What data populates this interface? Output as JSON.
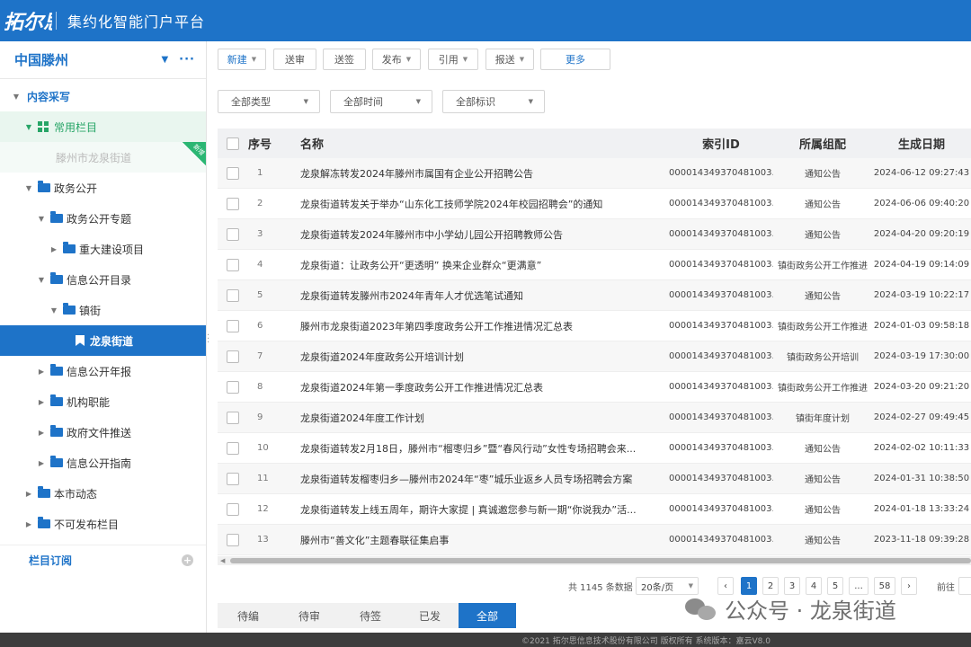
{
  "header": {
    "logo_text": "拓尔思",
    "app_title": "集约化智能门户平台"
  },
  "site": {
    "name": "中国滕州",
    "dropdown_glyph": "▼",
    "more_glyph": "···"
  },
  "sidebar": {
    "content_section": "内容采写",
    "common_columns": "常用栏目",
    "faded_item": "滕州市龙泉街道",
    "new_badge": "新增",
    "gov_public": "政务公开",
    "gov_special": "政务公开专题",
    "major_projects": "重大建设项目",
    "info_catalog": "信息公开目录",
    "towns": "镇街",
    "active_item": "龙泉街道",
    "annual_report": "信息公开年报",
    "org_functions": "机构职能",
    "gov_docs": "政府文件推送",
    "info_guide": "信息公开指南",
    "city_news": "本市动态",
    "unpublishable": "不可发布栏目",
    "column_subscribe": "栏目订阅"
  },
  "toolbar": {
    "new": "新建",
    "review": "送审",
    "sign": "送签",
    "publish": "发布",
    "cite": "引用",
    "submit": "报送",
    "more": "更多"
  },
  "filters": {
    "type": "全部类型",
    "time": "全部时间",
    "tag": "全部标识"
  },
  "table": {
    "headers": {
      "no": "序号",
      "name": "名称",
      "index_id": "索引ID",
      "group": "所属组配",
      "date": "生成日期"
    },
    "rows": [
      {
        "no": "1",
        "name": "龙泉解冻转发2024年滕州市属国有企业公开招聘公告",
        "index_id": "000014349370481003...",
        "group": "通知公告",
        "date": "2024-06-12 09:27:43"
      },
      {
        "no": "2",
        "name": "龙泉街道转发关于举办“山东化工技师学院2024年校园招聘会”的通知",
        "index_id": "000014349370481003...",
        "group": "通知公告",
        "date": "2024-06-06 09:40:20"
      },
      {
        "no": "3",
        "name": "龙泉街道转发2024年滕州市中小学幼儿园公开招聘教师公告",
        "index_id": "000014349370481003...",
        "group": "通知公告",
        "date": "2024-04-20 09:20:19"
      },
      {
        "no": "4",
        "name": "龙泉街道：让政务公开“更透明” 换来企业群众“更满意”",
        "index_id": "000014349370481003...",
        "group": "镇街政务公开工作推进",
        "date": "2024-04-19 09:14:09"
      },
      {
        "no": "5",
        "name": "龙泉街道转发滕州市2024年青年人才优选笔试通知",
        "index_id": "000014349370481003...",
        "group": "通知公告",
        "date": "2024-03-19 10:22:17"
      },
      {
        "no": "6",
        "name": "滕州市龙泉街道2023年第四季度政务公开工作推进情况汇总表",
        "index_id": "000014349370481003...",
        "group": "镇街政务公开工作推进",
        "date": "2024-01-03 09:58:18"
      },
      {
        "no": "7",
        "name": "龙泉街道2024年度政务公开培训计划",
        "index_id": "000014349370481003...",
        "group": "镇街政务公开培训",
        "date": "2024-03-19 17:30:00"
      },
      {
        "no": "8",
        "name": "龙泉街道2024年第一季度政务公开工作推进情况汇总表",
        "index_id": "000014349370481003...",
        "group": "镇街政务公开工作推进",
        "date": "2024-03-20 09:21:20"
      },
      {
        "no": "9",
        "name": "龙泉街道2024年度工作计划",
        "index_id": "000014349370481003...",
        "group": "镇街年度计划",
        "date": "2024-02-27 09:49:45"
      },
      {
        "no": "10",
        "name": "龙泉街道转发2月18日，滕州市“榴枣归乡”暨“春风行动”女性专场招聘会来...",
        "index_id": "000014349370481003...",
        "group": "通知公告",
        "date": "2024-02-02 10:11:33"
      },
      {
        "no": "11",
        "name": "龙泉街道转发榴枣归乡—滕州市2024年“枣”城乐业返乡人员专场招聘会方案",
        "index_id": "000014349370481003...",
        "group": "通知公告",
        "date": "2024-01-31 10:38:50"
      },
      {
        "no": "12",
        "name": "龙泉街道转发上线五周年，期许大家提 | 真诚邀您参与新一期“你说我办”活...",
        "index_id": "000014349370481003...",
        "group": "通知公告",
        "date": "2024-01-18 13:33:24"
      },
      {
        "no": "13",
        "name": "滕州市“善文化”主题春联征集启事",
        "index_id": "000014349370481003...",
        "group": "通知公告",
        "date": "2023-11-18 09:39:28"
      }
    ]
  },
  "pagination": {
    "total": "共 1145 条数据",
    "page_size": "20条/页",
    "prev": "‹",
    "next": "›",
    "pages": [
      "1",
      "2",
      "3",
      "4",
      "5",
      "...",
      "58"
    ],
    "goto_label": "前往"
  },
  "status_tabs": [
    "待编",
    "待审",
    "待签",
    "已发",
    "全部"
  ],
  "watermark": {
    "text": "公众号 · 龙泉街道"
  },
  "footer": {
    "text": "©2021 拓尔思信息技术股份有限公司 版权所有 系统版本：嘉云V8.0"
  },
  "colors": {
    "primary": "#1e73c8",
    "common_green": "#27a567",
    "header_bg": "#1e73c8"
  }
}
